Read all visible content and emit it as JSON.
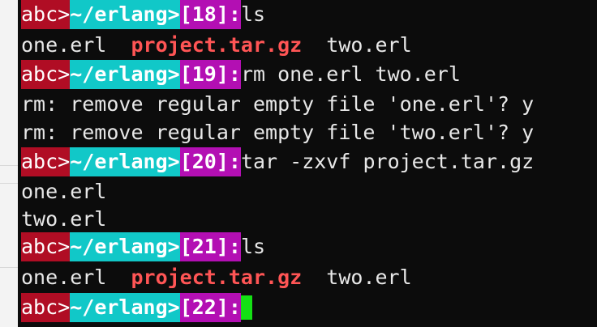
{
  "prompt": {
    "user": "abc>",
    "path": "~/erlang>"
  },
  "lines": [
    {
      "number": "[18]:",
      "command": "ls"
    },
    {
      "files": [
        "one.erl",
        "project.tar.gz",
        "two.erl"
      ]
    },
    {
      "number": "[19]:",
      "command": "rm one.erl two.erl"
    },
    {
      "text": "rm: remove regular empty file 'one.erl'? y"
    },
    {
      "text": "rm: remove regular empty file 'two.erl'? y"
    },
    {
      "number": "[20]:",
      "command": "tar -zxvf project.tar.gz"
    },
    {
      "text": "one.erl"
    },
    {
      "text": "two.erl"
    },
    {
      "number": "[21]:",
      "command": "ls"
    },
    {
      "files": [
        "one.erl",
        "project.tar.gz",
        "two.erl"
      ]
    },
    {
      "number": "[22]:",
      "command": ""
    }
  ],
  "colors": {
    "background": "#0c0c0c",
    "user_segment": "#b00d24",
    "path_segment": "#11c8c8",
    "number_segment": "#b30fb3",
    "archive_file": "#ff5555",
    "cursor": "#14e014"
  }
}
